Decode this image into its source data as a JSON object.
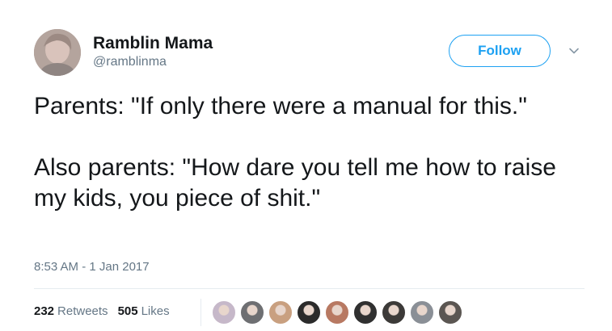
{
  "user": {
    "display_name": "Ramblin Mama",
    "handle": "@ramblinma"
  },
  "follow_label": "Follow",
  "tweet": {
    "paragraphs": [
      "Parents: \"If only there were a manual for this.\"",
      "Also parents: \"How dare you tell me how to raise my kids, you piece of shit.\""
    ],
    "timestamp": "8:53 AM - 1 Jan 2017"
  },
  "stats": {
    "retweets_count": "232",
    "retweets_label": "Retweets",
    "likes_count": "505",
    "likes_label": "Likes"
  },
  "likers": [
    {
      "color": "#c6b8c9"
    },
    {
      "color": "#6e6f72"
    },
    {
      "color": "#c9a080"
    },
    {
      "color": "#2b2b2b"
    },
    {
      "color": "#b87962"
    },
    {
      "color": "#303030"
    },
    {
      "color": "#3c3a38"
    },
    {
      "color": "#8a8f96"
    },
    {
      "color": "#5b5652"
    }
  ],
  "icons": {
    "avatar": "user-avatar",
    "chevron": "chevron-down-icon"
  }
}
